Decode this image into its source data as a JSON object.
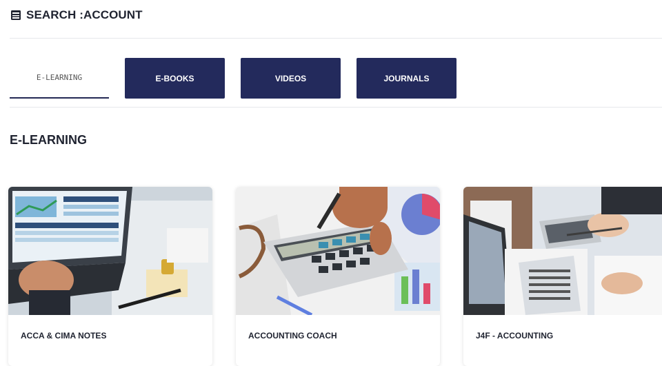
{
  "header": {
    "icon": "book-icon",
    "title": "SEARCH :ACCOUNT"
  },
  "tabs": [
    {
      "label": "E-LEARNING",
      "active": true
    },
    {
      "label": "E-BOOKS",
      "active": false
    },
    {
      "label": "VIDEOS",
      "active": false
    },
    {
      "label": "JOURNALS",
      "active": false
    }
  ],
  "section": {
    "title": "E-LEARNING"
  },
  "cards": [
    {
      "label": "ACCA & CIMA NOTES",
      "image": "laptop-chart-photo"
    },
    {
      "label": "ACCOUNTING COACH",
      "image": "calculator-photo"
    },
    {
      "label": "J4F - ACCOUNTING",
      "image": "desk-calculator-photo"
    }
  ],
  "colors": {
    "accent": "#232a5c",
    "text": "#1f2330",
    "divider": "#e6e7eb"
  }
}
